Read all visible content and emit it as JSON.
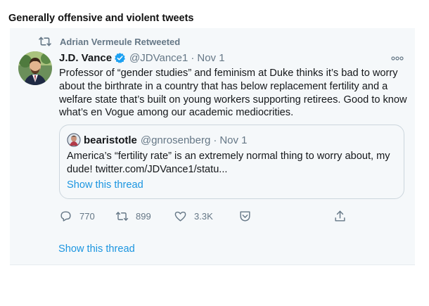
{
  "heading": "Generally offensive and violent tweets",
  "tweet": {
    "retweet_label": "Adrian Vermeule Retweeted",
    "author_name": "J.D. Vance",
    "handle": "@JDVance1",
    "separator": "·",
    "date": "Nov 1",
    "text": "Professor of “gender studies” and feminism at Duke thinks it’s bad to worry about the birthrate in a country that has below replacement fertility and a welfare state that’s built on young workers supporting retirees. Good to know what’s en Vogue among our academic mediocrities.",
    "quote": {
      "author_name": "bearistotle",
      "handle": "@gnrosenberg",
      "separator": "·",
      "date": "Nov 1",
      "text": "America’s “fertility rate” is an extremely normal thing to worry about, my dude! twitter.com/JDVance1/statu...",
      "show_thread": "Show this thread"
    },
    "actions": {
      "replies": "770",
      "retweets": "899",
      "likes": "3.3K"
    },
    "show_thread": "Show this thread"
  },
  "icons": {
    "retweeted": "retweet-icon",
    "verified": "verified-badge-icon",
    "more": "more-options-icon",
    "reply": "reply-icon",
    "retweet": "retweet-icon",
    "like": "heart-icon",
    "save": "save-icon",
    "share": "share-icon"
  },
  "colors": {
    "link": "#1b95e0",
    "secondary_text": "#657786",
    "card_background": "#f5f8fa",
    "verified": "#1da1f2"
  }
}
